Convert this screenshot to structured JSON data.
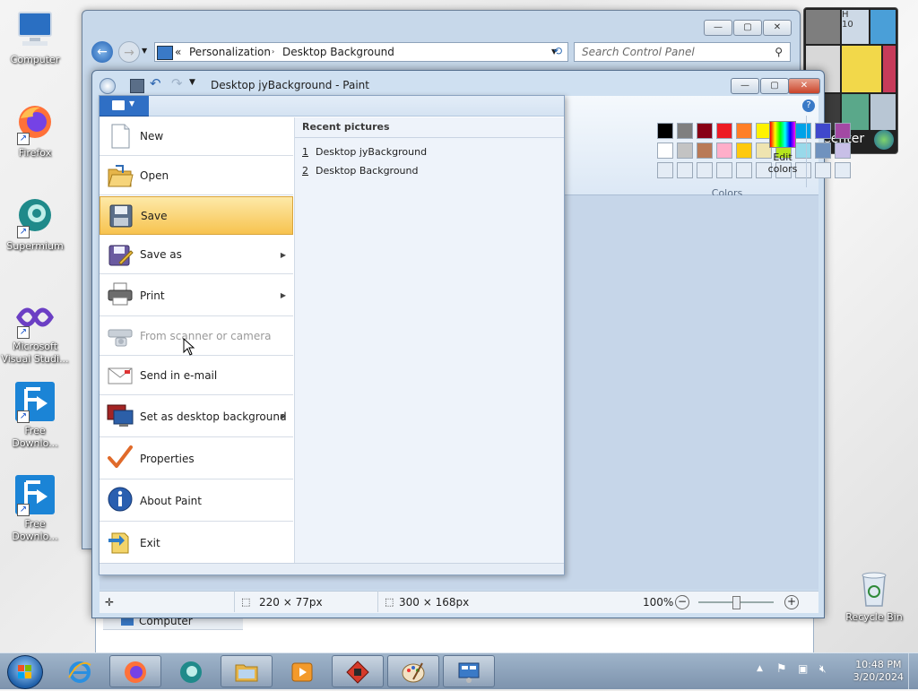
{
  "desktop": {
    "icons": [
      {
        "label": "Computer"
      },
      {
        "label": "Firefox"
      },
      {
        "label": "Supermium"
      },
      {
        "label": "Microsoft Visual Studi..."
      },
      {
        "label": "Free Downlo..."
      },
      {
        "label": "Free Downlo..."
      }
    ],
    "recycle_bin": "Recycle Bin",
    "gadget_text": "Center",
    "gadget_letter": "H",
    "gadget_number": "10"
  },
  "control_panel": {
    "breadcrumb_sep": "«",
    "crumb1": "Personalization",
    "crumb2": "Desktop Background",
    "search_placeholder": "Search Control Panel",
    "nav_item": "Computer"
  },
  "paint": {
    "title": "Desktop jyBackground - Paint",
    "colors_label": "Colors",
    "edit_colors": "Edit colors",
    "palette_row1": [
      "#000000",
      "#7f7f7f",
      "#880015",
      "#ed1c24",
      "#ff7f27",
      "#fff200",
      "#22b14c",
      "#00a2e8",
      "#3f48cc",
      "#a349a4"
    ],
    "palette_row2": [
      "#ffffff",
      "#c3c3c3",
      "#b97a57",
      "#ffaec9",
      "#ffc90e",
      "#efe4b0",
      "#b5e61d",
      "#99d9ea",
      "#7092be",
      "#c8bfe7"
    ],
    "status": {
      "selection_size": "220 × 77px",
      "image_size": "300 × 168px",
      "zoom": "100%"
    }
  },
  "file_menu": {
    "items": [
      {
        "label": "New",
        "disabled": false,
        "submenu": false
      },
      {
        "label": "Open",
        "disabled": false,
        "submenu": false
      },
      {
        "label": "Save",
        "disabled": false,
        "submenu": false,
        "selected": true
      },
      {
        "label": "Save as",
        "disabled": false,
        "submenu": true
      },
      {
        "label": "Print",
        "disabled": false,
        "submenu": true
      },
      {
        "label": "From scanner or camera",
        "disabled": true,
        "submenu": false
      },
      {
        "label": "Send in e-mail",
        "disabled": false,
        "submenu": false
      },
      {
        "label": "Set as desktop background",
        "disabled": false,
        "submenu": true
      },
      {
        "label": "Properties",
        "disabled": false,
        "submenu": false
      },
      {
        "label": "About Paint",
        "disabled": false,
        "submenu": false
      },
      {
        "label": "Exit",
        "disabled": false,
        "submenu": false
      }
    ],
    "recent_header": "Recent pictures",
    "recent": [
      {
        "num": "1",
        "name": "Desktop jyBackground"
      },
      {
        "num": "2",
        "name": "Desktop Background"
      }
    ]
  },
  "taskbar": {
    "time": "10:48 PM",
    "date": "3/20/2024"
  }
}
